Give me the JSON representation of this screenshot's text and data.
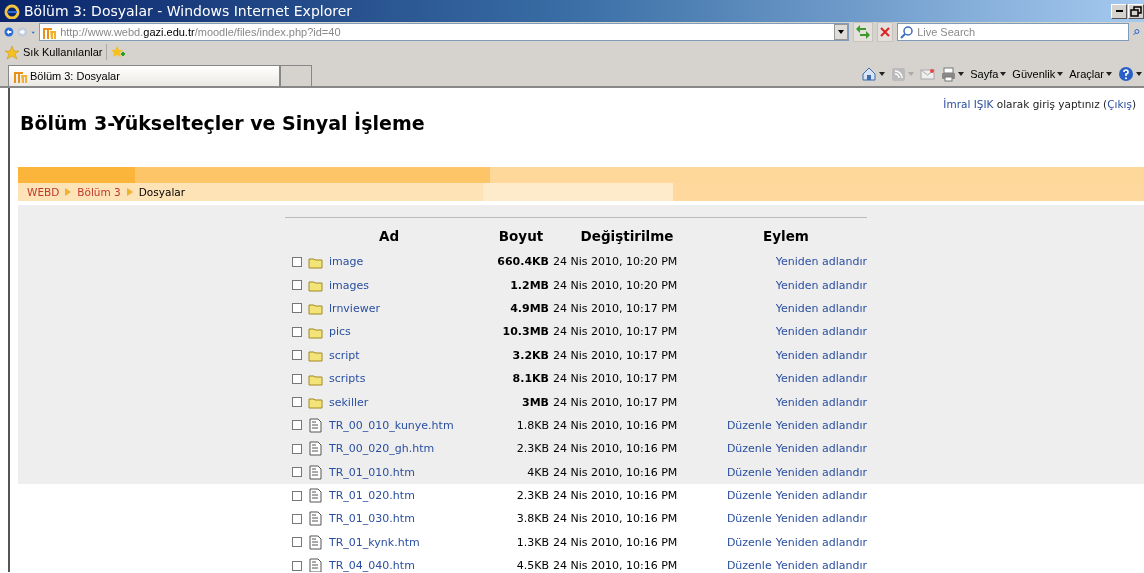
{
  "window": {
    "title": "Bölüm 3: Dosyalar - Windows Internet Explorer"
  },
  "address": {
    "url_prefix": "http://www.webd.",
    "url_domain": "gazi.edu.tr",
    "url_path": "/moodle/files/index.php?id=40"
  },
  "search": {
    "placeholder": "Live Search"
  },
  "favorites": {
    "label": "Sık Kullanılanlar"
  },
  "tabs": [
    {
      "label": "Bölüm 3: Dosyalar",
      "selected": true
    },
    {
      "selected": false
    }
  ],
  "command_bar": [
    "Sayfa",
    "Güvenlik",
    "Araçlar"
  ],
  "page": {
    "heading": "Bölüm 3-Yükselteçler ve Sinyal İşleme",
    "band": true,
    "login": {
      "user": "İmral IŞIK",
      "text": " olarak giriş yaptınız (",
      "logout": "Çıkış",
      "after": ")"
    },
    "breadcrumb": [
      {
        "label": "WEBD",
        "link": true
      },
      {
        "label": "Bölüm 3",
        "link": true
      },
      {
        "label": "Dosyalar",
        "link": false
      }
    ]
  },
  "table": {
    "columns": [
      "Ad",
      "Boyut",
      "Değiştirilme",
      "Eylem"
    ],
    "rows": [
      {
        "kind": "folder",
        "checked": false,
        "name": "image",
        "size": "660.4KB",
        "modified": "24 Nis 2010, 10:20 PM",
        "actions": [
          "Yeniden adlandır"
        ]
      },
      {
        "kind": "folder",
        "checked": false,
        "name": "images",
        "size": "1.2MB",
        "modified": "24 Nis 2010, 10:20 PM",
        "actions": [
          "Yeniden adlandır"
        ]
      },
      {
        "kind": "folder",
        "checked": false,
        "name": "lrnviewer",
        "size": "4.9MB",
        "modified": "24 Nis 2010, 10:17 PM",
        "actions": [
          "Yeniden adlandır"
        ]
      },
      {
        "kind": "folder",
        "checked": false,
        "name": "pics",
        "size": "10.3MB",
        "modified": "24 Nis 2010, 10:17 PM",
        "actions": [
          "Yeniden adlandır"
        ]
      },
      {
        "kind": "folder",
        "checked": false,
        "name": "script",
        "size": "3.2KB",
        "modified": "24 Nis 2010, 10:17 PM",
        "actions": [
          "Yeniden adlandır"
        ]
      },
      {
        "kind": "folder",
        "checked": false,
        "name": "scripts",
        "size": "8.1KB",
        "modified": "24 Nis 2010, 10:17 PM",
        "actions": [
          "Yeniden adlandır"
        ]
      },
      {
        "kind": "folder",
        "checked": false,
        "name": "sekiller",
        "size": "3MB",
        "modified": "24 Nis 2010, 10:17 PM",
        "actions": [
          "Yeniden adlandır"
        ]
      },
      {
        "kind": "file",
        "checked": false,
        "name": "TR_00_010_kunye.htm",
        "size": "1.8KB",
        "modified": "24 Nis 2010, 10:16 PM",
        "actions": [
          "Düzenle",
          "Yeniden adlandır"
        ]
      },
      {
        "kind": "file",
        "checked": false,
        "name": "TR_00_020_gh.htm",
        "size": "2.3KB",
        "modified": "24 Nis 2010, 10:16 PM",
        "actions": [
          "Düzenle",
          "Yeniden adlandır"
        ]
      },
      {
        "kind": "file",
        "checked": false,
        "name": "TR_01_010.htm",
        "size": "4KB",
        "modified": "24 Nis 2010, 10:16 PM",
        "actions": [
          "Düzenle",
          "Yeniden adlandır"
        ]
      },
      {
        "kind": "file",
        "checked": false,
        "name": "TR_01_020.htm",
        "size": "2.3KB",
        "modified": "24 Nis 2010, 10:16 PM",
        "actions": [
          "Düzenle",
          "Yeniden adlandır"
        ]
      },
      {
        "kind": "file",
        "checked": false,
        "name": "TR_01_030.htm",
        "size": "3.8KB",
        "modified": "24 Nis 2010, 10:16 PM",
        "actions": [
          "Düzenle",
          "Yeniden adlandır"
        ]
      },
      {
        "kind": "file",
        "checked": false,
        "name": "TR_01_kynk.htm",
        "size": "1.3KB",
        "modified": "24 Nis 2010, 10:16 PM",
        "actions": [
          "Düzenle",
          "Yeniden adlandır"
        ]
      },
      {
        "kind": "file",
        "checked": false,
        "name": "TR_04_040.htm",
        "size": "4.5KB",
        "modified": "24 Nis 2010, 10:16 PM",
        "actions": [
          "Düzenle",
          "Yeniden adlandır"
        ]
      }
    ]
  }
}
